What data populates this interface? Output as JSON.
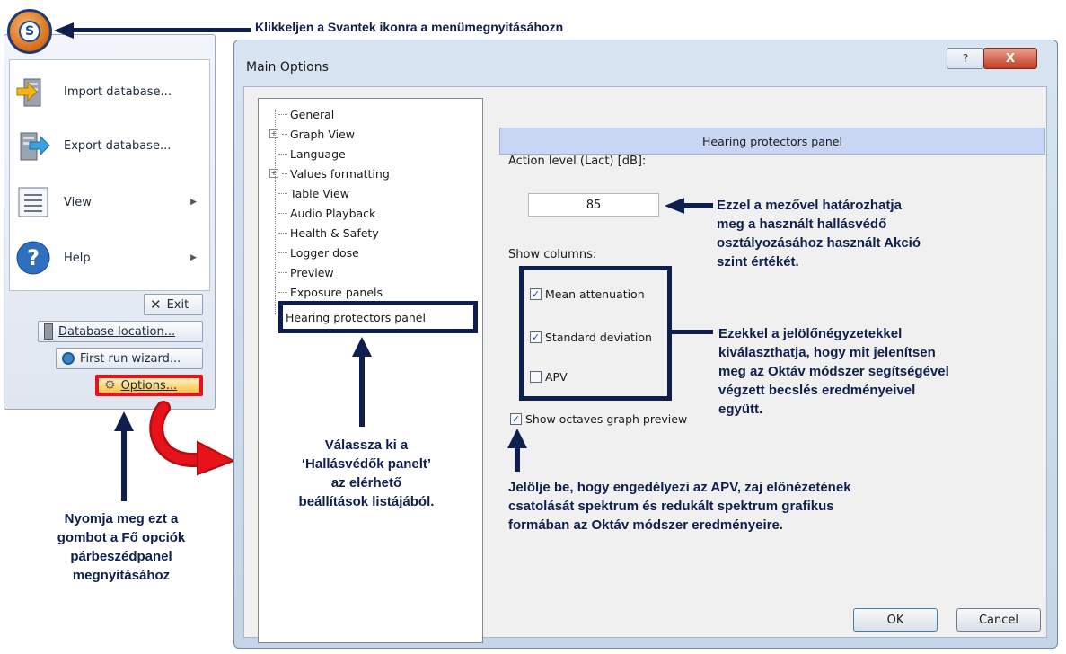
{
  "app_menu": {
    "logo_glyph": "S",
    "items": [
      {
        "label": "Import database...",
        "icon": "import-database-icon"
      },
      {
        "label": "Export database...",
        "icon": "export-database-icon"
      },
      {
        "label": "View",
        "icon": "view-icon"
      },
      {
        "label": "Help",
        "icon": "help-icon"
      }
    ],
    "exit_label": "Exit",
    "database_location_label": "Database location...",
    "first_run_wizard_label": "First run wizard...",
    "options_label": "Options..."
  },
  "dialog": {
    "title": "Main Options",
    "help_glyph": "?",
    "close_glyph": "X",
    "tree": [
      "General",
      "Graph View",
      "Language",
      "Values formatting",
      "Table View",
      "Audio Playback",
      "Health & Safety",
      "Logger dose",
      "Preview",
      "Exposure panels",
      "Hearing protectors panel"
    ],
    "panel_header": "Hearing protectors panel",
    "action_level_label": "Action level (Lact) [dB]:",
    "action_level_value": "85",
    "show_columns_label": "Show columns:",
    "checkboxes": [
      {
        "label": "Mean attenuation",
        "checked": true
      },
      {
        "label": "Standard deviation",
        "checked": true
      },
      {
        "label": "APV",
        "checked": false
      }
    ],
    "show_octaves_label": "Show octaves graph preview",
    "show_octaves_checked": true,
    "ok_label": "OK",
    "cancel_label": "Cancel"
  },
  "annotations": {
    "top": "Klikkeljen a Svantek ikonra a menümegnyitásáhozn",
    "action_level": [
      "Ezzel a mezővel határozhatja",
      "meg a használt hallásvédő",
      "osztályozásához használt Akció",
      "szint értékét."
    ],
    "checkboxes": [
      "Ezekkel a jelölőnégyzetekkel",
      "kiválaszthatja, hogy  mit jelenítsen",
      "meg az Oktáv módszer  segítségével",
      "végzett becslés eredményeivel",
      "együtt."
    ],
    "tree_select": [
      "Válassza ki a",
      "‘Hallásvédők panelt’",
      "az elérhető",
      "beállítások listájából."
    ],
    "octaves": [
      "Jelölje be, hogy engedélyezi az APV, zaj előnézetének",
      "csatolását spektrum és redukált spektrum grafikus",
      "formában az Oktáv módszer eredményeire."
    ],
    "options_button": [
      "Nyomja meg ezt a",
      "gombot a Fő opciók",
      "párbeszédpanel",
      "megnyitásához"
    ]
  },
  "colors": {
    "annotation": "#0f1f4d",
    "highlight_red": "#e8131a",
    "panel_header": "#c9d6f3"
  }
}
